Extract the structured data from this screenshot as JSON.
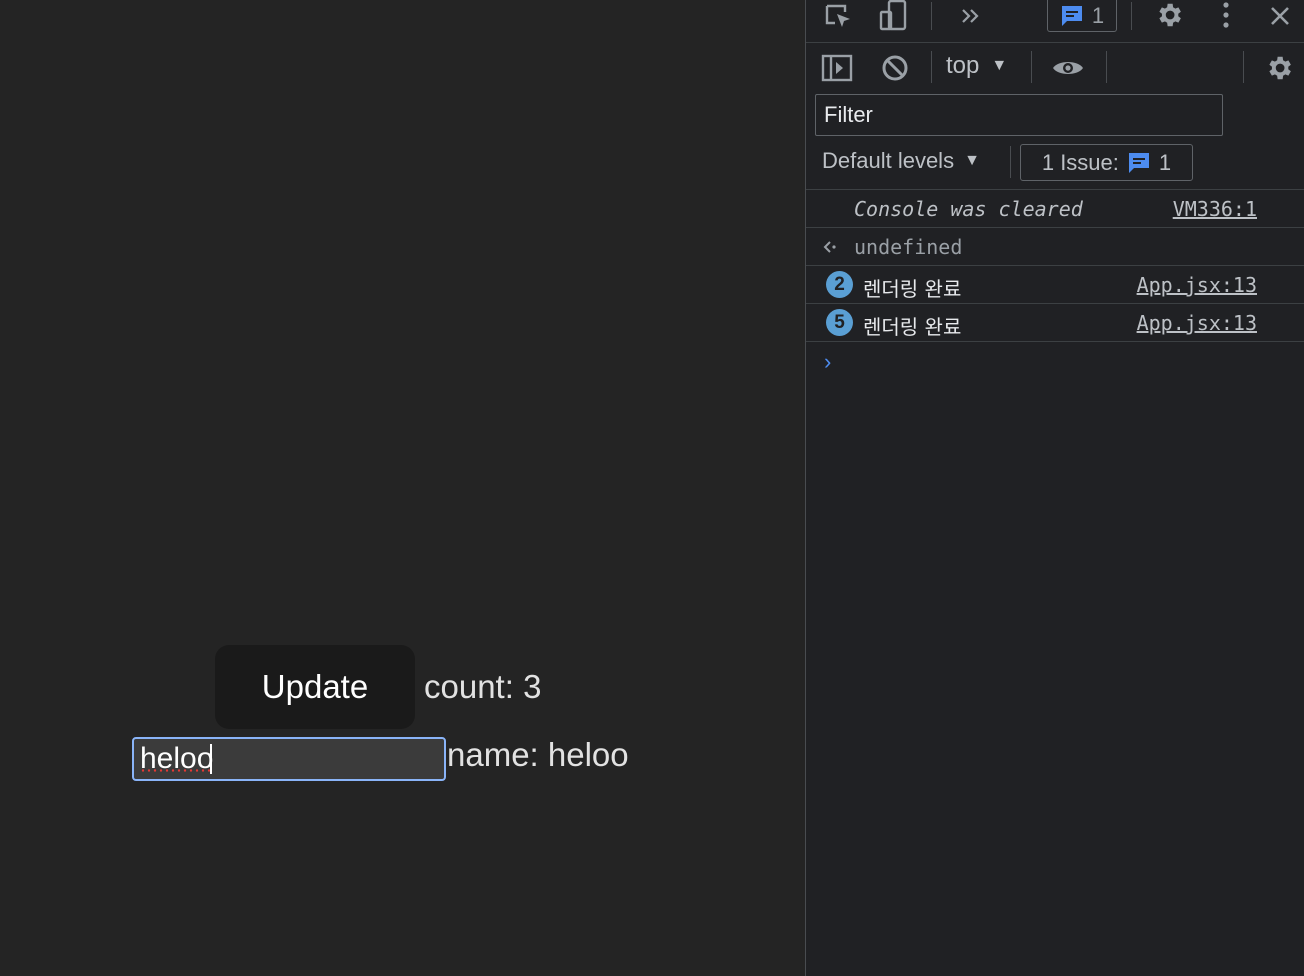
{
  "app": {
    "update_button": "Update",
    "count_text": "count: 3",
    "name_input_value": "heloo",
    "name_text": "name: heloo"
  },
  "devtools": {
    "issues_count": "1",
    "context": "top",
    "filter_placeholder": "Filter",
    "levels_label": "Default levels",
    "issue_label": "1 Issue:",
    "issue_count": "1",
    "console": [
      {
        "text": "Console was cleared",
        "source": "VM336:1"
      },
      {
        "text": "undefined"
      },
      {
        "count": "2",
        "text": "렌더링 완료",
        "source": "App.jsx:13"
      },
      {
        "count": "5",
        "text": "렌더링 완료",
        "source": "App.jsx:13"
      }
    ],
    "prompt_glyph": "›"
  },
  "icons": {
    "inspect": "inspect-element-icon",
    "device": "device-toolbar-icon",
    "more_tabs": "more-tabs-chevron-icon",
    "issues": "issues-message-icon",
    "settings": "gear-icon",
    "kebab": "kebab-menu-icon",
    "close": "close-icon",
    "sidebar": "show-sidebar-icon",
    "clear": "clear-console-icon",
    "eye": "live-expression-eye-icon"
  },
  "colors": {
    "page_bg": "#242424",
    "devtools_bg": "#202124",
    "accent_blue": "#4d8cf0",
    "badge_blue": "#5a9fd4",
    "input_focus": "#8ab4f8"
  }
}
